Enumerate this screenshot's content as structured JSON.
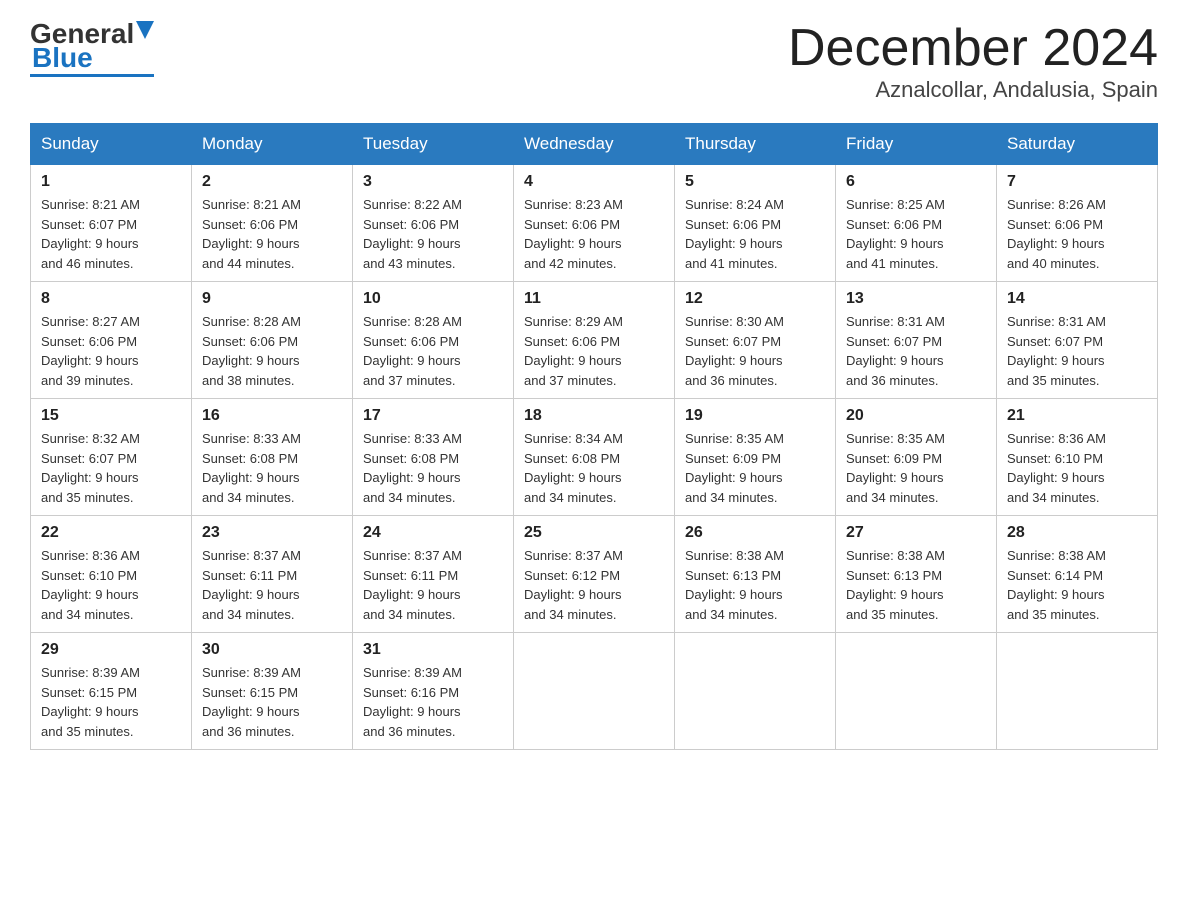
{
  "header": {
    "logo_general": "General",
    "logo_blue": "Blue",
    "title": "December 2024",
    "subtitle": "Aznalcollar, Andalusia, Spain"
  },
  "days_of_week": [
    "Sunday",
    "Monday",
    "Tuesday",
    "Wednesday",
    "Thursday",
    "Friday",
    "Saturday"
  ],
  "weeks": [
    [
      {
        "day": "1",
        "sunrise": "8:21 AM",
        "sunset": "6:07 PM",
        "daylight": "9 hours and 46 minutes."
      },
      {
        "day": "2",
        "sunrise": "8:21 AM",
        "sunset": "6:06 PM",
        "daylight": "9 hours and 44 minutes."
      },
      {
        "day": "3",
        "sunrise": "8:22 AM",
        "sunset": "6:06 PM",
        "daylight": "9 hours and 43 minutes."
      },
      {
        "day": "4",
        "sunrise": "8:23 AM",
        "sunset": "6:06 PM",
        "daylight": "9 hours and 42 minutes."
      },
      {
        "day": "5",
        "sunrise": "8:24 AM",
        "sunset": "6:06 PM",
        "daylight": "9 hours and 41 minutes."
      },
      {
        "day": "6",
        "sunrise": "8:25 AM",
        "sunset": "6:06 PM",
        "daylight": "9 hours and 41 minutes."
      },
      {
        "day": "7",
        "sunrise": "8:26 AM",
        "sunset": "6:06 PM",
        "daylight": "9 hours and 40 minutes."
      }
    ],
    [
      {
        "day": "8",
        "sunrise": "8:27 AM",
        "sunset": "6:06 PM",
        "daylight": "9 hours and 39 minutes."
      },
      {
        "day": "9",
        "sunrise": "8:28 AM",
        "sunset": "6:06 PM",
        "daylight": "9 hours and 38 minutes."
      },
      {
        "day": "10",
        "sunrise": "8:28 AM",
        "sunset": "6:06 PM",
        "daylight": "9 hours and 37 minutes."
      },
      {
        "day": "11",
        "sunrise": "8:29 AM",
        "sunset": "6:06 PM",
        "daylight": "9 hours and 37 minutes."
      },
      {
        "day": "12",
        "sunrise": "8:30 AM",
        "sunset": "6:07 PM",
        "daylight": "9 hours and 36 minutes."
      },
      {
        "day": "13",
        "sunrise": "8:31 AM",
        "sunset": "6:07 PM",
        "daylight": "9 hours and 36 minutes."
      },
      {
        "day": "14",
        "sunrise": "8:31 AM",
        "sunset": "6:07 PM",
        "daylight": "9 hours and 35 minutes."
      }
    ],
    [
      {
        "day": "15",
        "sunrise": "8:32 AM",
        "sunset": "6:07 PM",
        "daylight": "9 hours and 35 minutes."
      },
      {
        "day": "16",
        "sunrise": "8:33 AM",
        "sunset": "6:08 PM",
        "daylight": "9 hours and 34 minutes."
      },
      {
        "day": "17",
        "sunrise": "8:33 AM",
        "sunset": "6:08 PM",
        "daylight": "9 hours and 34 minutes."
      },
      {
        "day": "18",
        "sunrise": "8:34 AM",
        "sunset": "6:08 PM",
        "daylight": "9 hours and 34 minutes."
      },
      {
        "day": "19",
        "sunrise": "8:35 AM",
        "sunset": "6:09 PM",
        "daylight": "9 hours and 34 minutes."
      },
      {
        "day": "20",
        "sunrise": "8:35 AM",
        "sunset": "6:09 PM",
        "daylight": "9 hours and 34 minutes."
      },
      {
        "day": "21",
        "sunrise": "8:36 AM",
        "sunset": "6:10 PM",
        "daylight": "9 hours and 34 minutes."
      }
    ],
    [
      {
        "day": "22",
        "sunrise": "8:36 AM",
        "sunset": "6:10 PM",
        "daylight": "9 hours and 34 minutes."
      },
      {
        "day": "23",
        "sunrise": "8:37 AM",
        "sunset": "6:11 PM",
        "daylight": "9 hours and 34 minutes."
      },
      {
        "day": "24",
        "sunrise": "8:37 AM",
        "sunset": "6:11 PM",
        "daylight": "9 hours and 34 minutes."
      },
      {
        "day": "25",
        "sunrise": "8:37 AM",
        "sunset": "6:12 PM",
        "daylight": "9 hours and 34 minutes."
      },
      {
        "day": "26",
        "sunrise": "8:38 AM",
        "sunset": "6:13 PM",
        "daylight": "9 hours and 34 minutes."
      },
      {
        "day": "27",
        "sunrise": "8:38 AM",
        "sunset": "6:13 PM",
        "daylight": "9 hours and 35 minutes."
      },
      {
        "day": "28",
        "sunrise": "8:38 AM",
        "sunset": "6:14 PM",
        "daylight": "9 hours and 35 minutes."
      }
    ],
    [
      {
        "day": "29",
        "sunrise": "8:39 AM",
        "sunset": "6:15 PM",
        "daylight": "9 hours and 35 minutes."
      },
      {
        "day": "30",
        "sunrise": "8:39 AM",
        "sunset": "6:15 PM",
        "daylight": "9 hours and 36 minutes."
      },
      {
        "day": "31",
        "sunrise": "8:39 AM",
        "sunset": "6:16 PM",
        "daylight": "9 hours and 36 minutes."
      },
      null,
      null,
      null,
      null
    ]
  ],
  "labels": {
    "sunrise": "Sunrise:",
    "sunset": "Sunset:",
    "daylight": "Daylight:"
  }
}
